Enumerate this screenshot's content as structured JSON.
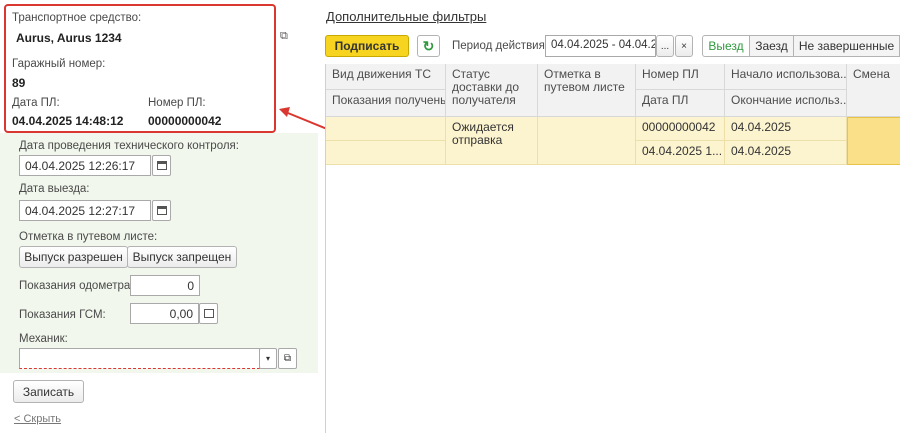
{
  "vehicle_card": {
    "vehicle_label": "Транспортное средство:",
    "vehicle_value": "Aurus, Aurus 1234",
    "garage_label": "Гаражный номер:",
    "garage_value": "89",
    "date_pl_label": "Дата ПЛ:",
    "date_pl_value": "04.04.2025 14:48:12",
    "number_pl_label": "Номер ПЛ:",
    "number_pl_value": "00000000042"
  },
  "form": {
    "tech_control_label": "Дата проведения технического контроля:",
    "tech_control_value": "04.04.2025 12:26:17",
    "departure_label": "Дата выезда:",
    "departure_value": "04.04.2025 12:27:17",
    "waybill_mark_label": "Отметка в путевом листе:",
    "release_allowed": "Выпуск разрешен",
    "release_forbidden": "Выпуск запрещен",
    "odometer_label": "Показания одометра:",
    "odometer_value": "0",
    "fuel_label": "Показания ГСМ:",
    "fuel_value": "0,00",
    "mechanic_label": "Механик:",
    "mechanic_value": "",
    "save_label": "Записать",
    "hide_label": "< Скрыть"
  },
  "toolbar": {
    "filters_link": "Дополнительные фильтры",
    "sign_label": "Подписать",
    "period_label": "Период действия:",
    "period_value": "04.04.2025 - 04.04.2(",
    "period_more": "...",
    "period_clear": "×",
    "filter_out": "Выезд",
    "filter_in": "Заезд",
    "filter_unfinished": "Не завершенные"
  },
  "table": {
    "headers": {
      "movement_type": "Вид движения ТС",
      "readings": "Показания получены",
      "delivery_status": "Статус доставки до получателя",
      "waybill_mark": "Отметка в путевом листе",
      "pl_number": "Номер ПЛ",
      "pl_date": "Дата ПЛ",
      "usage_start": "Начало использова...",
      "usage_end": "Окончание использ...",
      "shift": "Смена"
    },
    "rows": [
      {
        "movement_type": "",
        "readings": "",
        "delivery_status": "Ожидается отправка",
        "waybill_mark": "",
        "pl_number": "00000000042",
        "pl_date": "04.04.2025 1...",
        "usage_start": "04.04.2025",
        "usage_end": "04.04.2025",
        "shift": ""
      }
    ]
  },
  "colors": {
    "accent_yellow": "#f6d41f",
    "highlight_red": "#d9372f",
    "selected_row": "#fcf3cf",
    "green_panel": "#f1f7ec"
  },
  "icons": {
    "open_external": "external-link-icon",
    "calendar": "calendar-icon",
    "refresh": "refresh-icon",
    "dropdown": "chevron-down-icon",
    "arrow": "annotation-arrow"
  }
}
